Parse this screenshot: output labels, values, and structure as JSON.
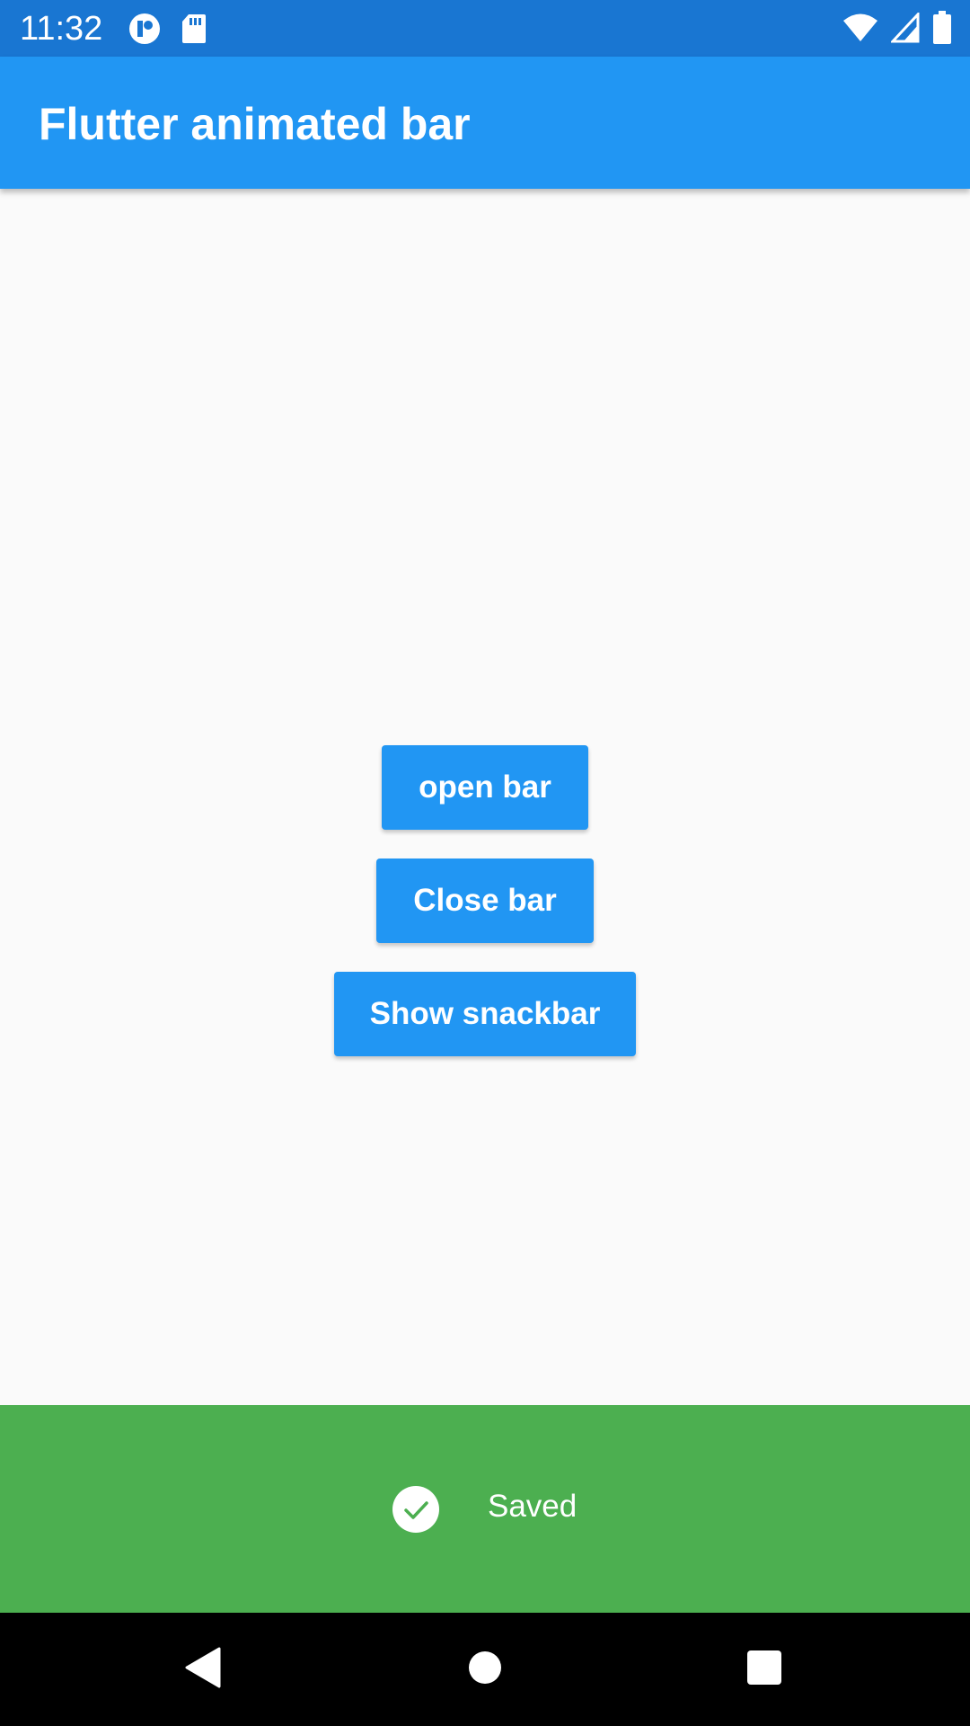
{
  "status_bar": {
    "time": "11:32",
    "background": "#1976d2",
    "left_icons": [
      "notification-app-icon",
      "sd-card-icon"
    ],
    "right_icons": [
      "wifi-icon",
      "signal-icon",
      "battery-icon"
    ]
  },
  "app_bar": {
    "title": "Flutter animated bar",
    "background": "#2196f3"
  },
  "buttons": {
    "open_label": "open bar",
    "close_label": "Close bar",
    "snackbar_label": "Show snackbar",
    "color": "#2196f3"
  },
  "saved_bar": {
    "icon": "check-circle-icon",
    "text": "Saved",
    "background": "#4caf50"
  },
  "nav_bar": {
    "buttons": [
      "back-icon",
      "home-icon",
      "recents-icon"
    ]
  }
}
